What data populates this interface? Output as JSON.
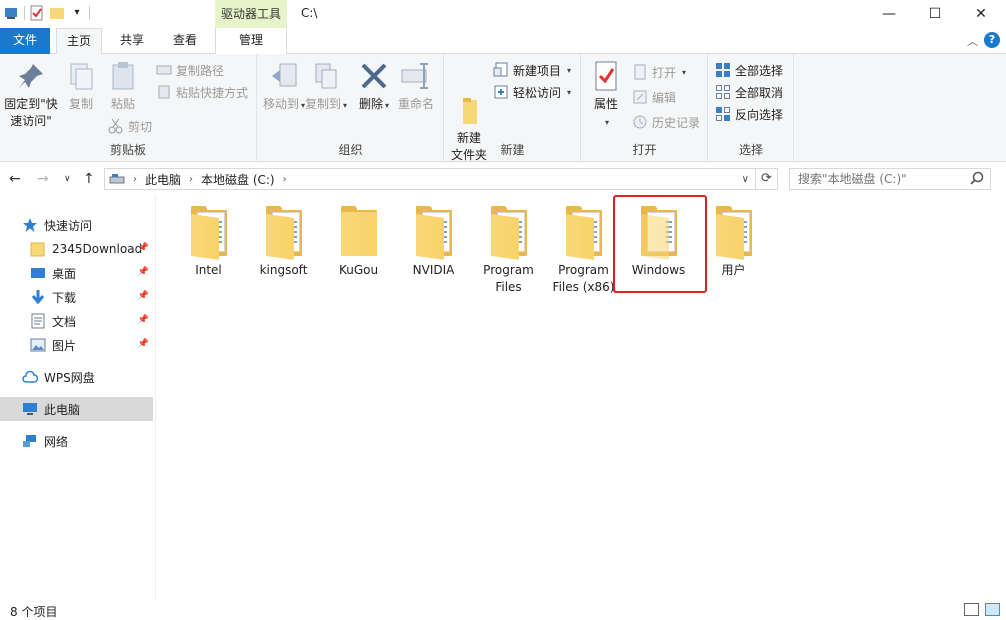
{
  "titlebar": {
    "context_tab": "驱动器工具",
    "path": "C:\\",
    "minimize": "—",
    "maximize": "☐",
    "close": "✕"
  },
  "tabs": {
    "file": "文件",
    "home": "主页",
    "share": "共享",
    "view": "查看",
    "manage": "管理",
    "help": "?"
  },
  "ribbon": {
    "clipboard": {
      "label": "剪贴板",
      "pin": "固定到\"快速访问\"",
      "copy": "复制",
      "paste": "粘贴",
      "copy_path": "复制路径",
      "paste_shortcut": "粘贴快捷方式",
      "cut": "剪切"
    },
    "organize": {
      "label": "组织",
      "move_to": "移动到",
      "copy_to": "复制到",
      "delete": "删除",
      "rename": "重命名"
    },
    "new": {
      "label": "新建",
      "new_folder": "新建\n文件夹",
      "new_item": "新建项目",
      "easy_access": "轻松访问"
    },
    "open": {
      "label": "打开",
      "properties": "属性",
      "open": "打开",
      "edit": "编辑",
      "history": "历史记录"
    },
    "select": {
      "label": "选择",
      "select_all": "全部选择",
      "select_none": "全部取消",
      "invert": "反向选择"
    }
  },
  "address": {
    "crumbs": [
      "此电脑",
      "本地磁盘 (C:)"
    ],
    "search_placeholder": "搜索\"本地磁盘 (C:)\""
  },
  "nav": {
    "quick_access": "快速访问",
    "items": [
      {
        "label": "2345Download",
        "icon": "folder-icon"
      },
      {
        "label": "桌面",
        "icon": "desktop-icon"
      },
      {
        "label": "下载",
        "icon": "download-icon"
      },
      {
        "label": "文档",
        "icon": "document-icon"
      },
      {
        "label": "图片",
        "icon": "picture-icon"
      }
    ],
    "wps": "WPS网盘",
    "this_pc": "此电脑",
    "network": "网络"
  },
  "files": [
    {
      "name": "Intel"
    },
    {
      "name": "kingsoft"
    },
    {
      "name": "KuGou"
    },
    {
      "name": "NVIDIA"
    },
    {
      "name": "Program Files"
    },
    {
      "name": "Program Files (x86)"
    },
    {
      "name": "Windows"
    },
    {
      "name": "用户"
    }
  ],
  "status": {
    "count": "8 个项目"
  },
  "colors": {
    "accent": "#1979ca",
    "context_tab_bg": "#e7f4c9",
    "highlight": "#e02020",
    "folder": "#f7d877"
  }
}
